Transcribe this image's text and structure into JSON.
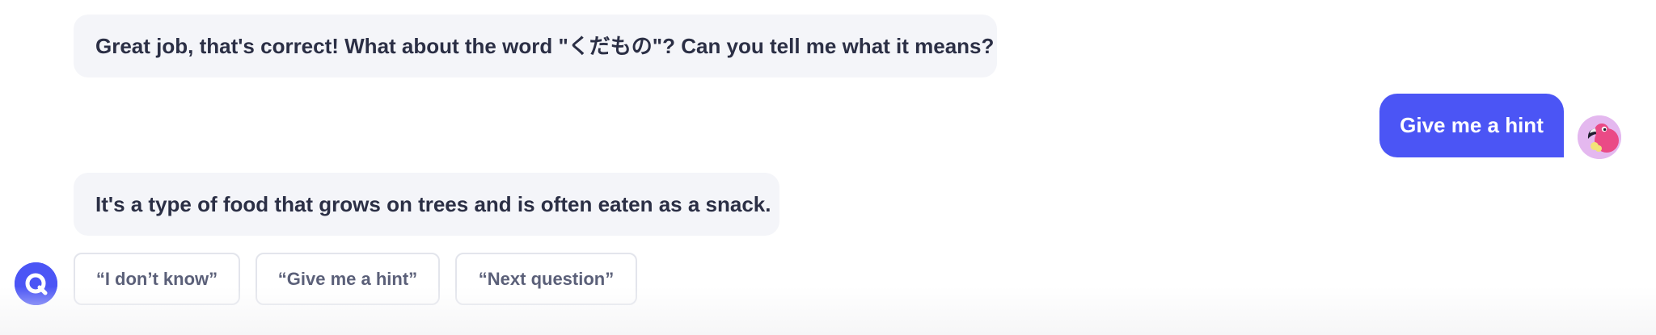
{
  "messages": [
    {
      "sender": "bot",
      "text": "Great job, that's correct! What about the word \"くだもの\"? Can you tell me what it means?"
    },
    {
      "sender": "user",
      "text": "Give me a hint"
    },
    {
      "sender": "bot",
      "text": "It's a type of food that grows on trees and is often eaten as a snack."
    }
  ],
  "suggestions": [
    "“I don’t know”",
    "“Give me a hint”",
    "“Next question”"
  ],
  "colors": {
    "accent": "#4b55f5",
    "bot_bubble": "#f4f5f9",
    "text": "#2b2f45",
    "chip_text": "#5b6079",
    "chip_border": "#e3e5ec",
    "user_avatar_bg": "#e4b8ef"
  },
  "icons": {
    "user_avatar": "flamingo-avatar-icon",
    "bot_avatar": "chat-bubble-logo-icon"
  }
}
